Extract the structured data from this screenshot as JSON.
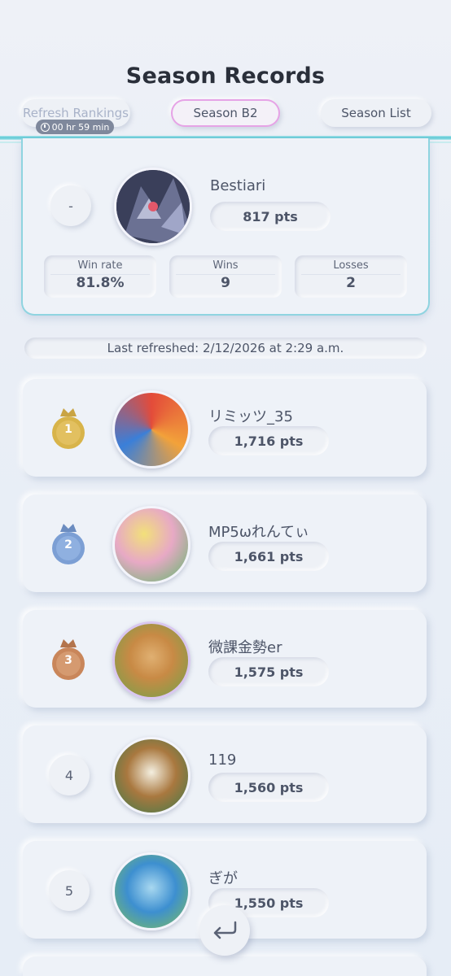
{
  "header": {
    "title": "Season Records",
    "refresh_label": "Refresh Rankings",
    "timer": "00 hr 59 min",
    "season_label": "Season B2",
    "season_list_label": "Season List"
  },
  "my_record": {
    "rank": "-",
    "name": "Bestiari",
    "points": "817 pts",
    "stats": [
      {
        "label": "Win rate",
        "value": "81.8%"
      },
      {
        "label": "Wins",
        "value": "9"
      },
      {
        "label": "Losses",
        "value": "2"
      }
    ]
  },
  "last_refreshed": "Last refreshed: 2/12/2026 at 2:29 a.m.",
  "rankings": [
    {
      "rank": "1",
      "name": "リミッツ_35",
      "points": "1,716 pts",
      "medal": "gold"
    },
    {
      "rank": "2",
      "name": "MP5ωれんてぃ",
      "points": "1,661 pts",
      "medal": "silver"
    },
    {
      "rank": "3",
      "name": "微課金勢er",
      "points": "1,575 pts",
      "medal": "bronze"
    },
    {
      "rank": "4",
      "name": "119",
      "points": "1,560 pts"
    },
    {
      "rank": "5",
      "name": "ぎが",
      "points": "1,550 pts"
    }
  ],
  "colors": {
    "accent_cyan": "#5bc8d4",
    "season_border": "#e6a3e6",
    "gold": "#d8b44a",
    "silver": "#7c9fd4",
    "bronze": "#c9865a"
  },
  "icons": {
    "back": "return-arrow-icon",
    "timer": "clock-icon",
    "medal": "crown-medal-icon"
  }
}
